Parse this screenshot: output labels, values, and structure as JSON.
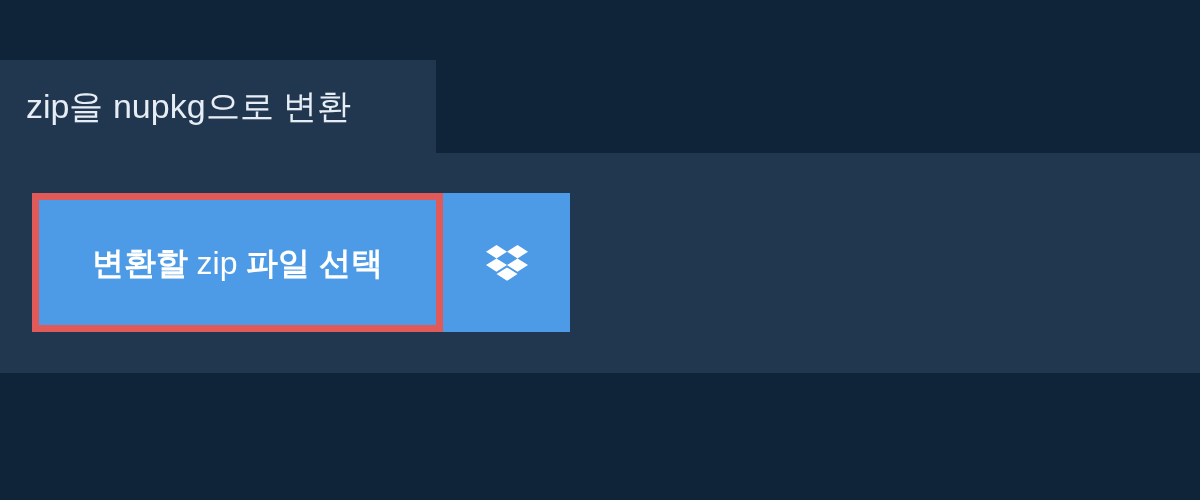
{
  "tab": {
    "title": "zip을 nupkg으로 변환"
  },
  "select_button": {
    "label": "**변환할** zip **파일 선택**"
  }
}
